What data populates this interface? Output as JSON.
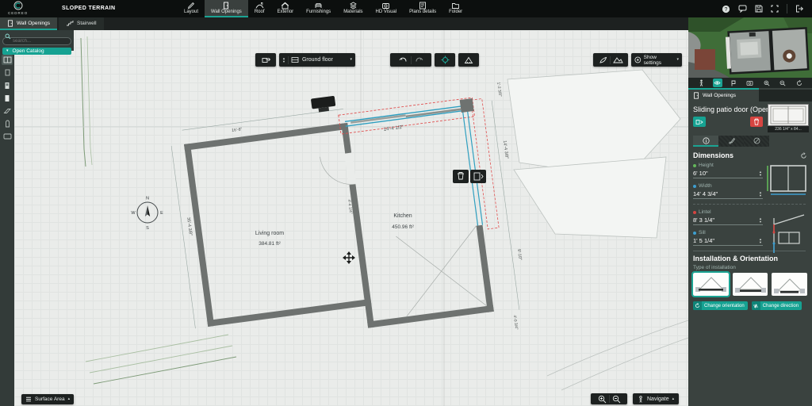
{
  "colors": {
    "accent": "#1ba393",
    "danger": "#d64541",
    "selection_blue": "#2f9fc0",
    "selection_red": "#e04f4f",
    "wall_gray": "#6e7270"
  },
  "header": {
    "logo": "CEDREO",
    "project": "SLOPED TERRAIN",
    "menu": [
      {
        "label": "Layout",
        "active": false
      },
      {
        "label": "Wall Openings",
        "active": true
      },
      {
        "label": "Roof",
        "active": false
      },
      {
        "label": "Exterior",
        "active": false
      },
      {
        "label": "Furnishings",
        "active": false
      },
      {
        "label": "Materials",
        "active": false
      },
      {
        "label": "HD Visual",
        "active": false
      },
      {
        "label": "Plans details",
        "active": false
      },
      {
        "label": "Folder",
        "active": false
      }
    ]
  },
  "subtabs": [
    {
      "label": "Wall Openings",
      "active": true
    },
    {
      "label": "Stairwell",
      "active": false
    }
  ],
  "catalog": {
    "search_placeholder": "search...",
    "open_catalog_label": "Open Catalog"
  },
  "canvas": {
    "floor_selector_label": "Ground floor",
    "show_settings_label": "Show settings",
    "rooms": [
      {
        "name": "Living room",
        "area": "384.81 ft²"
      },
      {
        "name": "Kitchen",
        "area": "450.96 ft²"
      }
    ],
    "dim_labels": [
      "14'-4 1/2\"",
      "16'-8\"",
      "35'-4 3/8\"",
      "1'-2 3/8\"",
      "14'-4 3/8\"",
      "9'-10\"",
      "4'-0 3/4\"",
      "4'-4 1/4\""
    ],
    "compass": {
      "north": "N",
      "west": "W",
      "east": "E",
      "south": "S"
    },
    "surface_area_label": "Surface Area",
    "navigate_label": "Navigate"
  },
  "right_panel": {
    "tab_label": "Wall Openings",
    "selection_title": "Sliding patio door (Opened)",
    "thumb_caption": "236 1/4\" x 84...",
    "dimensions": {
      "title": "Dimensions",
      "fields": [
        {
          "label": "Height",
          "value": "6' 10\"",
          "dot": "#63b75a"
        },
        {
          "label": "Width",
          "value": "14' 4 3/4\"",
          "dot": "#3e9ed0"
        },
        {
          "label": "Lintel",
          "value": "8' 3 1/4\"",
          "dot": "#d64541"
        },
        {
          "label": "Sill",
          "value": "1' 5 1/4\"",
          "dot": "#3e9ed0"
        }
      ]
    },
    "installation": {
      "title": "Installation & Orientation",
      "type_label": "Type of installation",
      "buttons": [
        {
          "label": "Change orientation"
        },
        {
          "label": "Change direction"
        }
      ]
    }
  },
  "glyphs": {
    "chevron_down": "▾",
    "chevron_up": "▴",
    "step_up": "▲",
    "step_down": "▼",
    "question": "?"
  }
}
